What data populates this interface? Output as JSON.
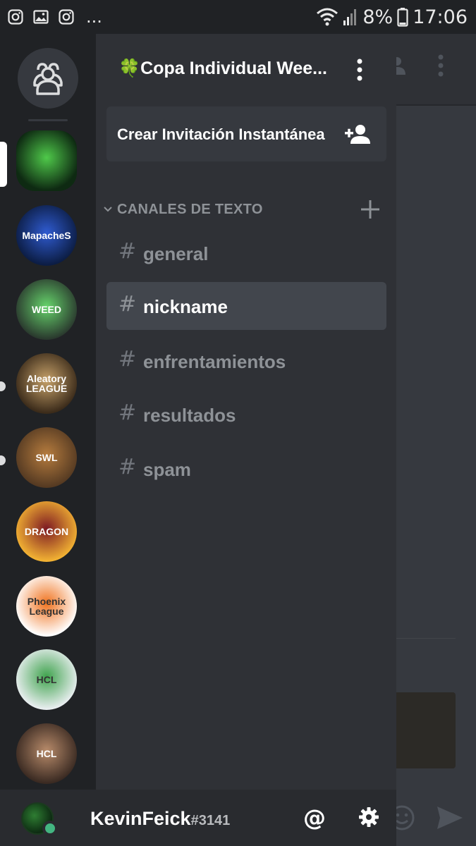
{
  "status_bar": {
    "notification_icons": [
      "instagram-icon",
      "gallery-icon",
      "instagram-icon"
    ],
    "overflow": "...",
    "battery": "8%",
    "time": "17:06"
  },
  "rail": {
    "servers": [
      {
        "name": "server-1",
        "label": "",
        "colors": [
          "#0e2a12",
          "#4fc94a"
        ]
      },
      {
        "name": "mapaches",
        "label": "MapacheS",
        "colors": [
          "#0c1d44",
          "#2f5bd0"
        ]
      },
      {
        "name": "weed",
        "label": "WEED",
        "colors": [
          "#2a3a2e",
          "#66d36b"
        ]
      },
      {
        "name": "aleatory-league",
        "label": "Aleatory LEAGUE",
        "colors": [
          "#3b2b1a",
          "#c7a26a"
        ]
      },
      {
        "name": "swl",
        "label": "SWL",
        "colors": [
          "#553a22",
          "#b67c3e"
        ]
      },
      {
        "name": "dragon",
        "label": "DRAGON",
        "colors": [
          "#f2b233",
          "#7d1a23"
        ]
      },
      {
        "name": "phoenix-league",
        "label": "Phoenix League",
        "colors": [
          "#ffffff",
          "#f0731f"
        ]
      },
      {
        "name": "hcl-1",
        "label": "HCL",
        "colors": [
          "#e9eef0",
          "#3fa34d"
        ]
      },
      {
        "name": "hcl-2",
        "label": "HCL",
        "colors": [
          "#3a2a22",
          "#b88b6a"
        ]
      }
    ]
  },
  "guild": {
    "emoji": "🍀",
    "name": "Copa Individual Wee..."
  },
  "invite": {
    "label": "Crear Invitación Instantánea"
  },
  "category": {
    "label": "CANALES DE TEXTO"
  },
  "channels": [
    {
      "name": "general",
      "active": false
    },
    {
      "name": "nickname",
      "active": true
    },
    {
      "name": "enfrentamientos",
      "active": false
    },
    {
      "name": "resultados",
      "active": false
    },
    {
      "name": "spam",
      "active": false
    }
  ],
  "user": {
    "username": "KevinFeick",
    "discriminator": "#3141",
    "status": "online"
  },
  "colors": {
    "rail_bg": "#202225",
    "drawer_bg": "#2f3136",
    "active_channel": "#42464d",
    "online": "#43b581"
  }
}
